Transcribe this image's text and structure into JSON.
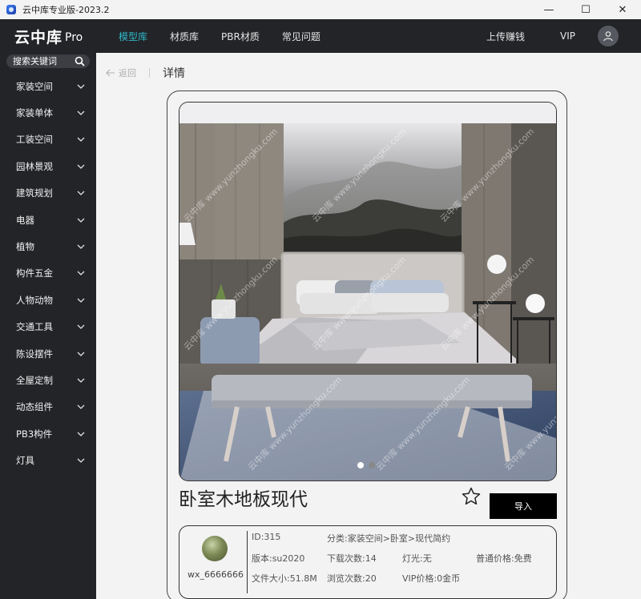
{
  "window": {
    "title": "云中库专业版-2023.2",
    "controls": {
      "minimize": "—",
      "maximize": "☐",
      "close": "✕"
    }
  },
  "logo": {
    "main": "云中库",
    "sub": "Pro"
  },
  "topnav": {
    "items": [
      "模型库",
      "材质库",
      "PBR材质",
      "常见问题"
    ],
    "active_index": 0,
    "right": {
      "upload": "上传赚钱",
      "vip": "VIP"
    }
  },
  "search": {
    "placeholder": "搜索关键词"
  },
  "sidebar": {
    "items": [
      "家装空间",
      "家装单体",
      "工装空间",
      "园林景观",
      "建筑规划",
      "电器",
      "植物",
      "构件五金",
      "人物动物",
      "交通工具",
      "陈设摆件",
      "全屋定制",
      "动态组件",
      "PB3构件",
      "灯具"
    ]
  },
  "breadcrumb": {
    "back": "返回",
    "title": "详情"
  },
  "model": {
    "title": "卧室木地板现代",
    "import_label": "导入",
    "image_count": 2,
    "image_active": 0,
    "watermark": "云中库 www.yunzhongku.com"
  },
  "author": {
    "name": "wx_6666666"
  },
  "info": {
    "id": "ID:315",
    "category": "分类:家装空间>卧室>现代简约",
    "version": "版本:su2020",
    "downloads": "下载次数:14",
    "lighting": "灯光:无",
    "normal_price": "普通价格:免费",
    "file_size": "文件大小:51.8M",
    "views": "浏览次数:20",
    "vip_price": "VIP价格:0金币"
  },
  "colors": {
    "sidebar_bg": "#232428",
    "accent": "#2fb8c8",
    "page_bg": "#f3f3f3",
    "button_bg": "#000000"
  }
}
